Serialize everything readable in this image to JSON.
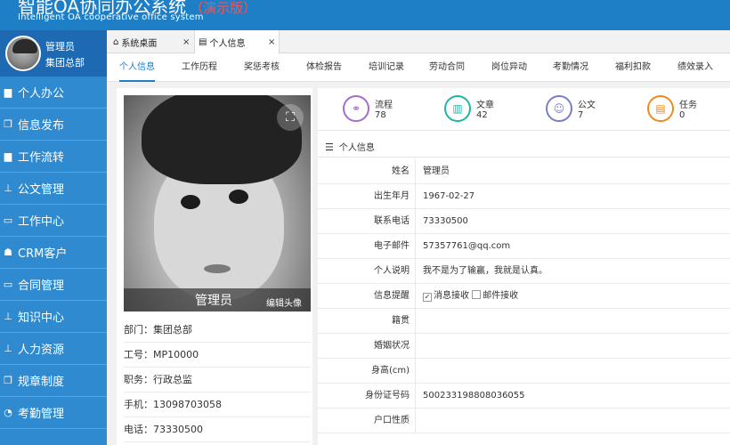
{
  "app": {
    "title": "智能OA协同办公系统",
    "demo_badge": "（演示版）",
    "subtitle": "Intelligent OA cooperative office system"
  },
  "user": {
    "name": "管理员",
    "dept": "集团总部"
  },
  "sidebar": {
    "items": [
      {
        "label": "个人办公",
        "icon": "briefcase-icon"
      },
      {
        "label": "信息发布",
        "icon": "file-icon"
      },
      {
        "label": "工作流转",
        "icon": "briefcase-icon"
      },
      {
        "label": "公文管理",
        "icon": "sitemap-icon"
      },
      {
        "label": "工作中心",
        "icon": "monitor-icon"
      },
      {
        "label": "CRM客户",
        "icon": "users-icon"
      },
      {
        "label": "合同管理",
        "icon": "contract-icon"
      },
      {
        "label": "知识中心",
        "icon": "sitemap-icon"
      },
      {
        "label": "人力资源",
        "icon": "sitemap-icon"
      },
      {
        "label": "规章制度",
        "icon": "file-icon"
      },
      {
        "label": "考勤管理",
        "icon": "clock-icon"
      }
    ]
  },
  "tabs": [
    {
      "label": "系统桌面",
      "icon": "home-icon"
    },
    {
      "label": "个人信息",
      "icon": "document-icon"
    }
  ],
  "subnav": [
    "个人信息",
    "工作历程",
    "奖惩考核",
    "体检报告",
    "培训记录",
    "劳动合同",
    "岗位异动",
    "考勤情况",
    "福利扣款",
    "绩效录入"
  ],
  "profile": {
    "photo_name": "管理员",
    "edit_avatar": "编辑头像",
    "lines": [
      "部门：集团总部",
      "工号：MP10000",
      "职务：行政总监",
      "手机：13098703058",
      "电话：73330500"
    ]
  },
  "stats": [
    {
      "label": "流程",
      "value": "78",
      "color": "#a66ad1",
      "icon": "flow-icon"
    },
    {
      "label": "文章",
      "value": "42",
      "color": "#1fb5a0",
      "icon": "book-icon"
    },
    {
      "label": "公文",
      "value": "7",
      "color": "#7a7ec8",
      "icon": "person-icon"
    },
    {
      "label": "任务",
      "value": "0",
      "color": "#ef8a1c",
      "icon": "task-icon"
    }
  ],
  "section_title": "个人信息",
  "details": [
    {
      "label": "姓名",
      "value": "管理员"
    },
    {
      "label": "出生年月",
      "value": "1967-02-27"
    },
    {
      "label": "联系电话",
      "value": "73330500"
    },
    {
      "label": "电子邮件",
      "value": "57357761@qq.com"
    },
    {
      "label": "个人说明",
      "value": "我不是为了输赢，我就是认真。"
    },
    {
      "label": "信息提醒",
      "value": ""
    },
    {
      "label": "籍贯",
      "value": ""
    },
    {
      "label": "婚姻状况",
      "value": ""
    },
    {
      "label": "身高(cm)",
      "value": ""
    },
    {
      "label": "身份证号码",
      "value": "500233198808036055"
    },
    {
      "label": "户口性质",
      "value": ""
    }
  ],
  "reminders": {
    "message_label": "消息接收",
    "message_checked": true,
    "email_label": "邮件接收",
    "email_checked": false
  }
}
